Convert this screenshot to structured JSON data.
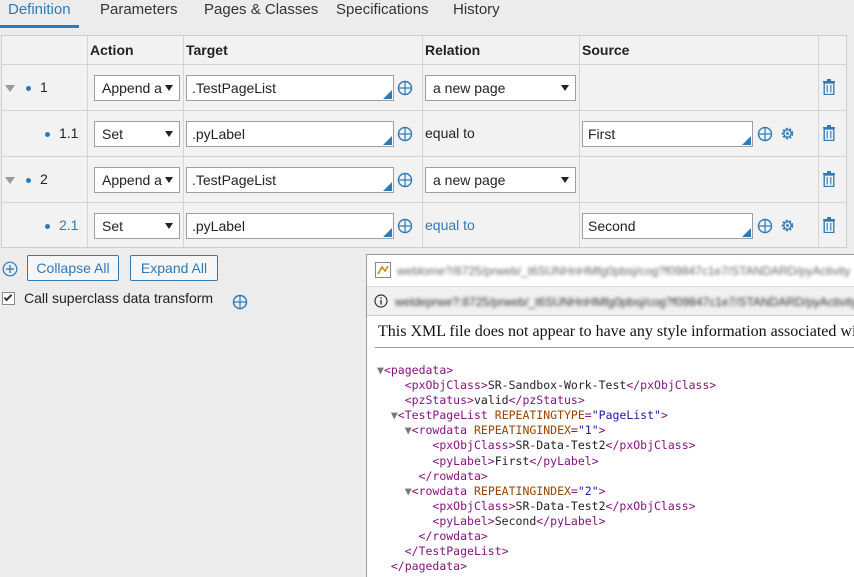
{
  "tabs": [
    {
      "label": "Definition",
      "active": true
    },
    {
      "label": "Parameters"
    },
    {
      "label": "Pages & Classes"
    },
    {
      "label": "Specifications"
    },
    {
      "label": "History"
    }
  ],
  "grid": {
    "headers": {
      "action": "Action",
      "target": "Target",
      "relation": "Relation",
      "source": "Source"
    },
    "rows": [
      {
        "num": "1",
        "action": "Append a",
        "target": ".TestPageList",
        "relation_select": "a new page",
        "source": ""
      },
      {
        "num": "1.1",
        "action": "Set",
        "target": ".pyLabel",
        "relation_text": "equal to",
        "source": "First"
      },
      {
        "num": "2",
        "action": "Append a",
        "target": ".TestPageList",
        "relation_select": "a new page",
        "source": ""
      },
      {
        "num": "2.1",
        "action": "Set",
        "target": ".pyLabel",
        "relation_text": "equal to",
        "source": "Second"
      }
    ]
  },
  "buttons": {
    "collapse_all": "Collapse All",
    "expand_all": "Expand All"
  },
  "checkbox": {
    "label": "Call superclass data transform",
    "checked": true
  },
  "popup": {
    "url_line_1": "weblome?/8725/prweb/_t6SUNHnHMfg0pbsj/cog?f09847c1e7/STANDARD/pyActivity",
    "url_line_2": "weldeprwe?:8725/prweb/_t6SUNHnHMfg0pbsj/cog?f09847c1e7/STANDARD/pyActivity",
    "notice": "This XML file does not appear to have any style information associated with it.",
    "xml": {
      "pagedata": "pagedata",
      "pxObjClass": "pxObjClass",
      "page_class": "SR-Sandbox-Work-Test",
      "pzStatus": "pzStatus",
      "status": "valid",
      "list_tag": "TestPageList",
      "repeating_attr": "REPEATINGTYPE",
      "repeating_val": "\"PageList\"",
      "rowdata": "rowdata",
      "index_attr": "REPEATINGINDEX",
      "index1": "\"1\"",
      "index2": "\"2\"",
      "row_class": "SR-Data-Test2",
      "pyLabel": "pyLabel",
      "label1": "First",
      "label2": "Second"
    }
  },
  "colors": {
    "accent": "#2c7ab8",
    "background": "#ececec",
    "tag": "#881280",
    "attr": "#994500",
    "attr_value": "#1a1aa6"
  }
}
